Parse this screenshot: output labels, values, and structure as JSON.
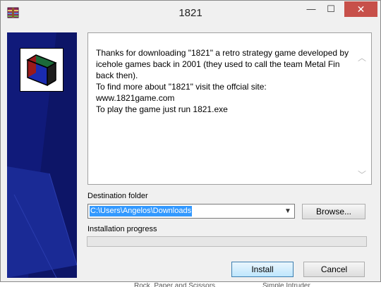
{
  "window": {
    "title": "1821",
    "minimize_glyph": "—",
    "maximize_glyph": "☐",
    "close_glyph": "✕"
  },
  "app_icon": "winrar-installer-icon",
  "logo_icon": "game-box-logo-icon",
  "info": {
    "text": "Thanks for downloading \"1821\" a retro strategy game developed by icehole games back in 2001 (they used to call the team Metal Fin back then).\nTo find more about \"1821\" visit the offcial site:\nwww.1821game.com\nTo play the game just run 1821.exe",
    "scroll_up_glyph": "︿",
    "scroll_down_glyph": "﹀"
  },
  "destination": {
    "label": "Destination folder",
    "value": "C:\\Users\\Angelos\\Downloads",
    "dropdown_glyph": "▼",
    "browse_label": "Browse..."
  },
  "progress": {
    "label": "Installation progress",
    "fraction": 0
  },
  "buttons": {
    "install": "Install",
    "cancel": "Cancel"
  },
  "background_text": {
    "left": "Rock, Paper and Scissors",
    "right": "Simple Intruder"
  },
  "colors": {
    "sidebar_blue": "#101a7a",
    "close_red": "#c7504a",
    "selection_blue": "#3399ff",
    "progress_green": "#06b025"
  }
}
